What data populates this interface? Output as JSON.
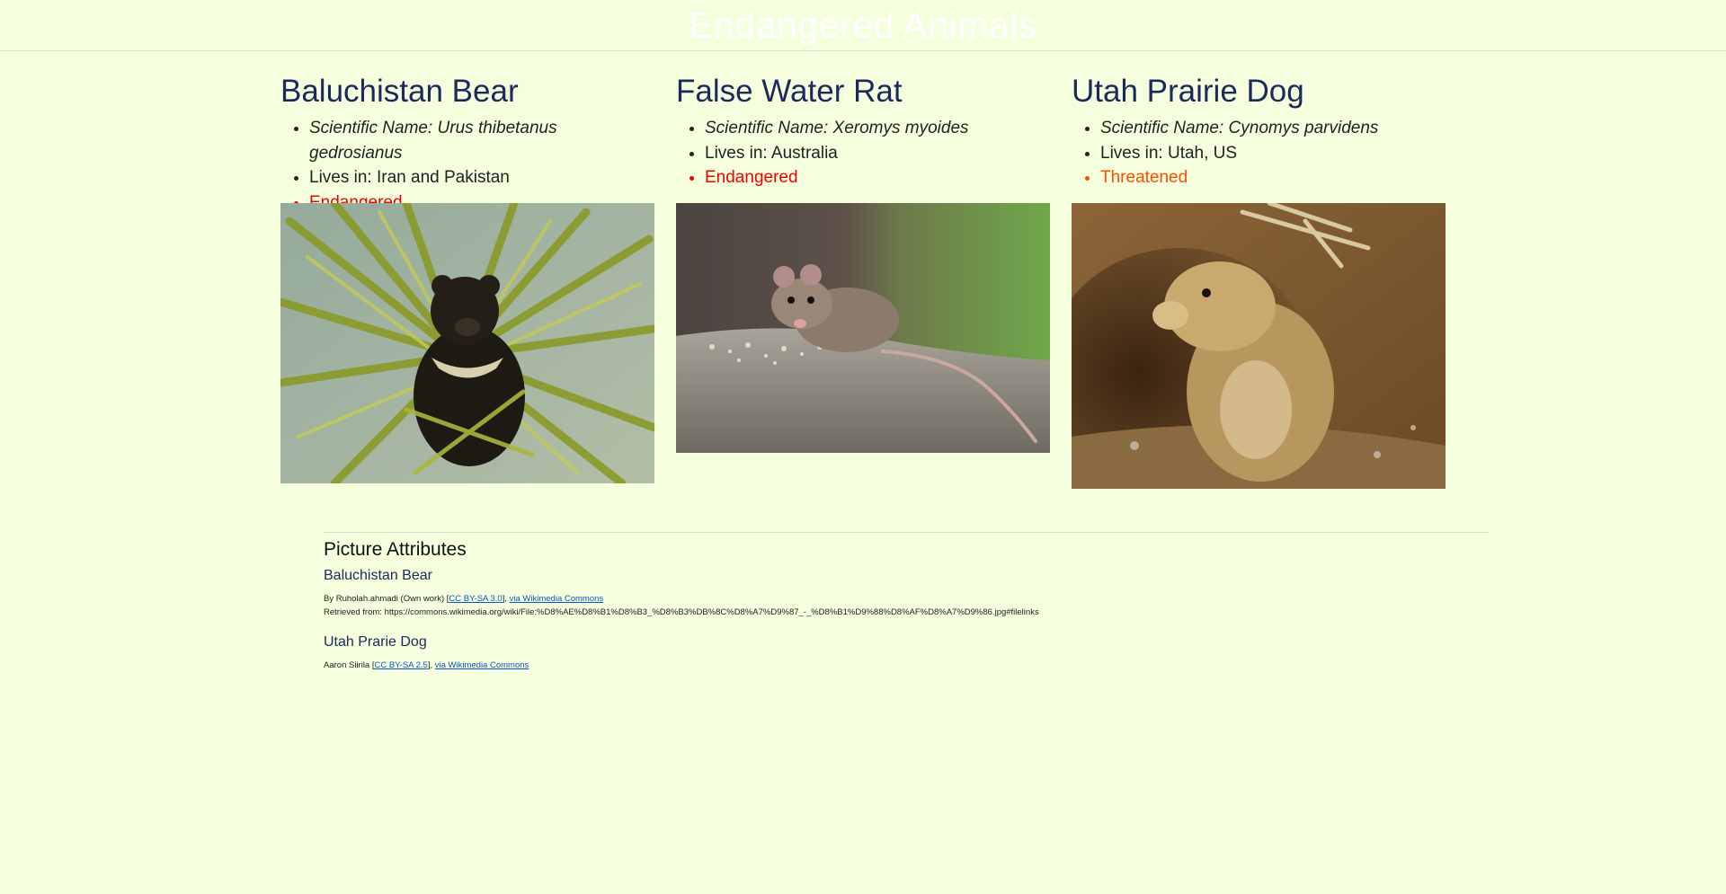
{
  "header": {
    "title": "Endangered Animals"
  },
  "animals": [
    {
      "name": "Baluchistan Bear",
      "scientific": "Scientific Name: Urus thibetanus gedrosianus",
      "lives_in": "Lives in: Iran and Pakistan",
      "status": "Endangered",
      "status_color": "#f20000"
    },
    {
      "name": "False Water Rat",
      "scientific": "Scientific Name: Xeromys myoides",
      "lives_in": "Lives in: Australia",
      "status": "Endangered",
      "status_color": "#f20000"
    },
    {
      "name": "Utah Prairie Dog",
      "scientific": "Scientific Name: Cynomys parvidens",
      "lives_in": "Lives in: Utah, US",
      "status": "Threatened",
      "status_color": "#ff4a00"
    }
  ],
  "attributes": {
    "title": "Picture Attributes",
    "bear": {
      "heading": "Baluchistan Bear",
      "prefix": "By Ruholah.ahmadi (Own work) [",
      "license_link": "CC BY-SA 3.0",
      "sep": "], ",
      "source_link": "via Wikimedia Commons",
      "retrieved": "Retrieved from: https://commons.wikimedia.org/wiki/File:%D8%AE%D8%B1%D8%B3_%D8%B3%DB%8C%D8%A7%D9%87_-_%D8%B1%D9%88%D8%AF%D8%A7%D9%86.jpg#filelinks"
    },
    "dog": {
      "heading": "Utah Prarie Dog",
      "prefix": "Aaron Siirila [",
      "license_link": "CC BY-SA 2.5",
      "sep": "], ",
      "source_link": "via Wikimedia Commons"
    }
  },
  "colors": {
    "background": "#f5ffdd",
    "heading": "#1a2a5c",
    "link": "#0a56c8"
  }
}
